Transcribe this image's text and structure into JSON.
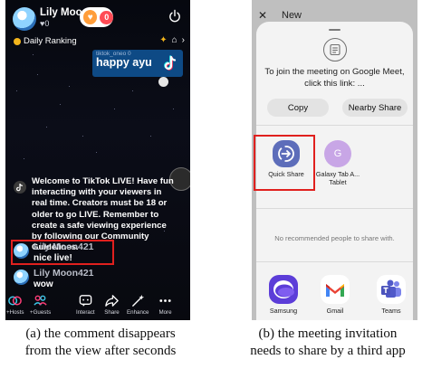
{
  "left_panel": {
    "host": {
      "name": "Lily Moo...",
      "likes": "♥0",
      "gift_count": "0"
    },
    "daily_ranking": "Daily Ranking",
    "banner": {
      "subtitle": "tiktok_oneo 0",
      "main_text": "happy ayu"
    },
    "welcome_message": "Welcome to TikTok LIVE! Have fun interacting with your viewers in real time. Creators must be 18 or older to go LIVE. Remember to create a safe viewing experience by following our Community Guidelines.",
    "comments": [
      {
        "user": "Lily Moon421",
        "text": "nice live!"
      },
      {
        "user": "Lily Moon421",
        "text": "wow"
      }
    ],
    "bottom_bar": [
      {
        "label": "+Hosts",
        "icon": "hosts-icon"
      },
      {
        "label": "+Guests",
        "icon": "guests-icon"
      },
      {
        "label": "Interact",
        "icon": "interact-icon"
      },
      {
        "label": "Share",
        "icon": "share-icon"
      },
      {
        "label": "Enhance",
        "icon": "enhance-icon"
      },
      {
        "label": "More",
        "icon": "more-icon"
      }
    ]
  },
  "right_panel": {
    "close_glyph": "✕",
    "title": "New",
    "share_message": "To join the meeting on Google Meet, click this link: ...",
    "buttons": {
      "copy": "Copy",
      "nearby_share": "Nearby Share"
    },
    "apps_top": [
      {
        "label": "Quick Share",
        "icon": "quick-share-icon"
      },
      {
        "label": "Galaxy Tab A... Tablet",
        "icon": "galaxy-tab-icon",
        "initial": "G"
      }
    ],
    "no_recommendations": "No recommended people to share with.",
    "apps_bottom": [
      {
        "label": "Samsung",
        "icon": "samsung-internet-icon"
      },
      {
        "label": "Gmail",
        "icon": "gmail-icon"
      },
      {
        "label": "Teams",
        "icon": "teams-icon"
      }
    ]
  },
  "captions": {
    "a_line1": "(a)  the comment disappears",
    "a_line2": "from the view after seconds",
    "b_line1": "(b)  the meeting invitation",
    "b_line2": "needs to share by a third app"
  },
  "colors": {
    "highlight": "#e0201e",
    "tiktok_bg": "#06080f",
    "banner": "#0e4a85",
    "quick_share": "#5d6dba",
    "galaxy": "#c8a6e6"
  }
}
